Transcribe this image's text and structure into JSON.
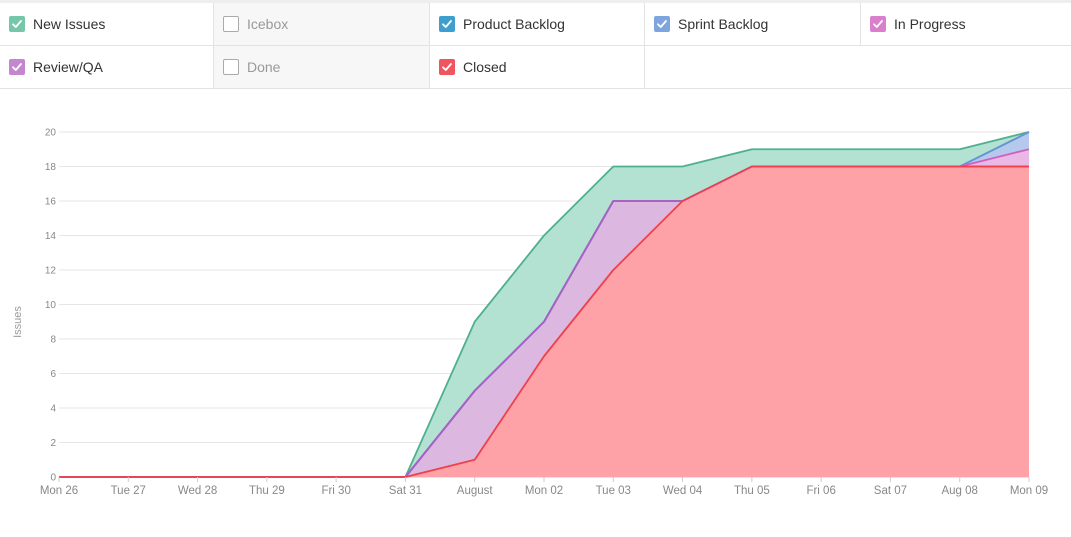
{
  "legend": {
    "rows": [
      [
        {
          "label": "New Issues",
          "checked": true,
          "color": "#74c7a9"
        },
        {
          "label": "Icebox",
          "checked": false,
          "color": "#cccccc"
        },
        {
          "label": "Product Backlog",
          "checked": true,
          "color": "#3d9fcf"
        },
        {
          "label": "Sprint Backlog",
          "checked": true,
          "color": "#7fa6dc"
        },
        {
          "label": "In Progress",
          "checked": true,
          "color": "#d97fcc"
        }
      ],
      [
        {
          "label": "Review/QA",
          "checked": true,
          "color": "#c486cf"
        },
        {
          "label": "Done",
          "checked": false,
          "color": "#cccccc"
        },
        {
          "label": "Closed",
          "checked": true,
          "color": "#f0545f"
        }
      ]
    ]
  },
  "chart_data": {
    "type": "area",
    "stacked": true,
    "ylabel": "Issues",
    "xlabel": "",
    "ylim": [
      0,
      20
    ],
    "yticks": [
      0,
      2,
      4,
      6,
      8,
      10,
      12,
      14,
      16,
      18,
      20
    ],
    "grid": true,
    "categories": [
      "Mon 26",
      "Tue 27",
      "Wed 28",
      "Thu 29",
      "Fri 30",
      "Sat 31",
      "August",
      "Mon 02",
      "Tue 03",
      "Wed 04",
      "Thu 05",
      "Fri 06",
      "Sat 07",
      "Aug 08",
      "Mon 09"
    ],
    "series": [
      {
        "name": "New Issues",
        "fill": "#b3e2d3",
        "stroke": "#4fb08d",
        "cumulative": [
          0,
          0,
          0,
          0,
          0,
          0,
          9,
          14,
          18,
          18,
          19,
          19,
          19,
          19,
          20
        ]
      },
      {
        "name": "Product Backlog",
        "fill": "#a9cde3",
        "stroke": "#3d8fc9",
        "cumulative": [
          0,
          0,
          0,
          0,
          0,
          0,
          5,
          9,
          16,
          16,
          18,
          18,
          18,
          18,
          20
        ]
      },
      {
        "name": "Sprint Backlog",
        "fill": "#b4c9ec",
        "stroke": "#6b93d4",
        "cumulative": [
          0,
          0,
          0,
          0,
          0,
          0,
          5,
          9,
          16,
          16,
          18,
          18,
          18,
          18,
          20
        ]
      },
      {
        "name": "In Progress",
        "fill": "#eab8e4",
        "stroke": "#d060c4",
        "cumulative": [
          0,
          0,
          0,
          0,
          0,
          0,
          5,
          9,
          16,
          16,
          18,
          18,
          18,
          18,
          19
        ]
      },
      {
        "name": "Review/QA",
        "fill": "#dcb8e0",
        "stroke": "#a462c3",
        "cumulative": [
          0,
          0,
          0,
          0,
          0,
          0,
          5,
          9,
          16,
          16,
          18,
          18,
          18,
          18,
          18
        ]
      },
      {
        "name": "Closed",
        "fill": "#ffa2a8",
        "stroke": "#f0404c",
        "cumulative": [
          0,
          0,
          0,
          0,
          0,
          0,
          1,
          7,
          12,
          16,
          18,
          18,
          18,
          18,
          18
        ]
      }
    ]
  }
}
